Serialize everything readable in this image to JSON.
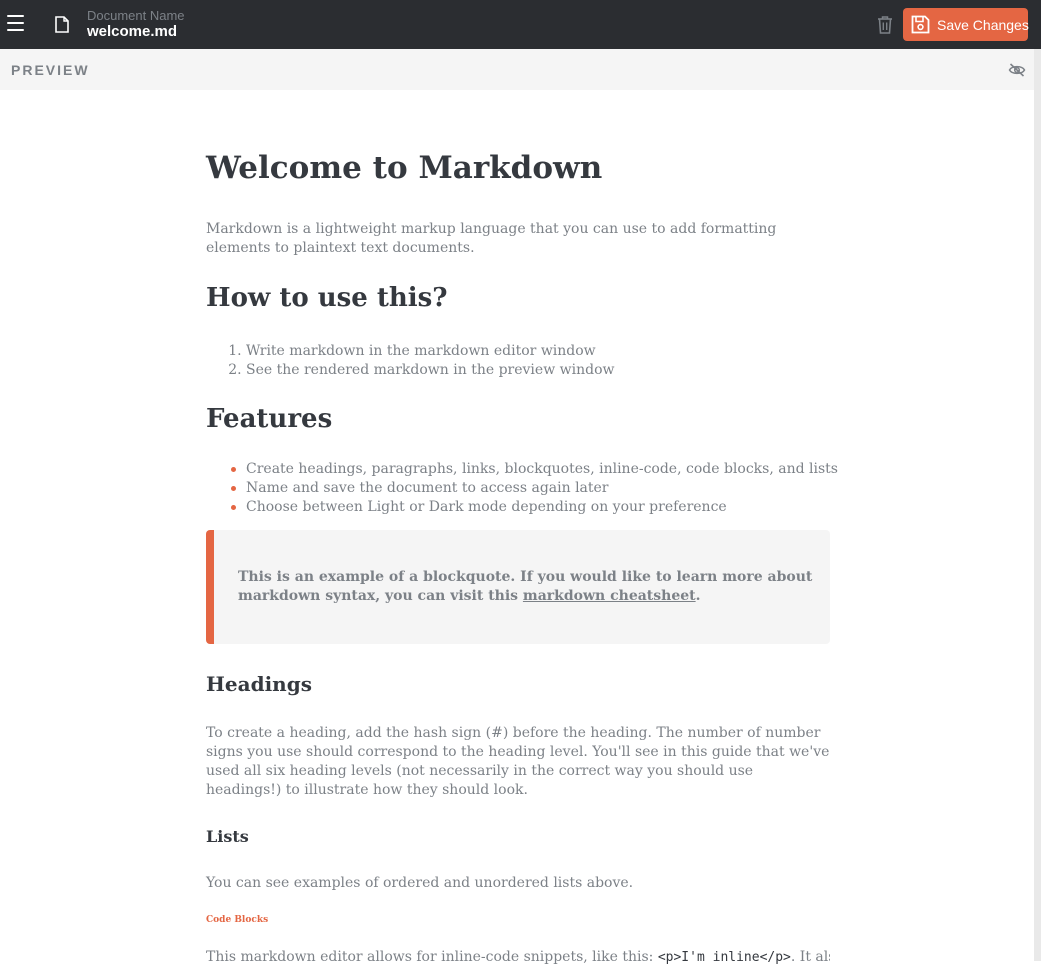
{
  "header": {
    "doc_label": "Document Name",
    "doc_name": "welcome.md",
    "save_label": "Save Changes",
    "accent": "#e46643"
  },
  "preview": {
    "label": "PREVIEW"
  },
  "content": {
    "h1": "Welcome to Markdown",
    "intro": "Markdown is a lightweight markup language that you can use to add formatting elements to plaintext text documents.",
    "h2_howto": "How to use this?",
    "ordered": [
      "Write markdown in the markdown editor window",
      "See the rendered markdown in the preview window"
    ],
    "h2_features": "Features",
    "unordered": [
      "Create headings, paragraphs, links, blockquotes, inline-code, code blocks, and lists",
      "Name and save the document to access again later",
      "Choose between Light or Dark mode depending on your preference"
    ],
    "blockquote": {
      "text": "This is an example of a blockquote. If you would like to learn more about markdown syntax, you can visit this",
      "link": "markdown cheatsheet",
      "end": "."
    },
    "h3_headings": "Headings",
    "headings_p": "To create a heading, add the hash sign (#) before the heading. The number of number signs you use should correspond to the heading level. You'll see in this guide that we've used all six heading levels (not necessarily in the correct way you should use headings!) to illustrate how they should look.",
    "h4_lists": "Lists",
    "lists_p": "You can see examples of ordered and unordered lists above.",
    "h6_code": "Code Blocks",
    "code_p_start": "This markdown editor allows for inline-code snippets, like this:",
    "code_inline": "<p>I'm inline</p>",
    "code_p_end": ". It also"
  }
}
